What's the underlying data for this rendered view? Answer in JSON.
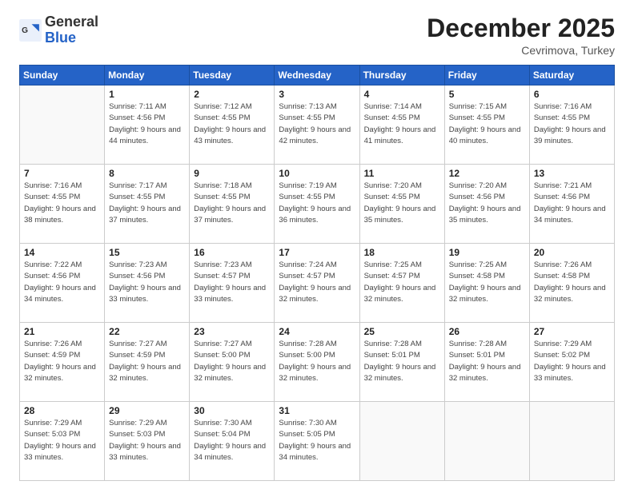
{
  "header": {
    "logo_general": "General",
    "logo_blue": "Blue",
    "month_title": "December 2025",
    "location": "Cevrimova, Turkey"
  },
  "calendar": {
    "days_of_week": [
      "Sunday",
      "Monday",
      "Tuesday",
      "Wednesday",
      "Thursday",
      "Friday",
      "Saturday"
    ],
    "weeks": [
      [
        {
          "day": "",
          "empty": true
        },
        {
          "day": "1",
          "sunrise": "7:11 AM",
          "sunset": "4:56 PM",
          "daylight": "9 hours and 44 minutes."
        },
        {
          "day": "2",
          "sunrise": "7:12 AM",
          "sunset": "4:55 PM",
          "daylight": "9 hours and 43 minutes."
        },
        {
          "day": "3",
          "sunrise": "7:13 AM",
          "sunset": "4:55 PM",
          "daylight": "9 hours and 42 minutes."
        },
        {
          "day": "4",
          "sunrise": "7:14 AM",
          "sunset": "4:55 PM",
          "daylight": "9 hours and 41 minutes."
        },
        {
          "day": "5",
          "sunrise": "7:15 AM",
          "sunset": "4:55 PM",
          "daylight": "9 hours and 40 minutes."
        },
        {
          "day": "6",
          "sunrise": "7:16 AM",
          "sunset": "4:55 PM",
          "daylight": "9 hours and 39 minutes."
        }
      ],
      [
        {
          "day": "7",
          "sunrise": "7:16 AM",
          "sunset": "4:55 PM",
          "daylight": "9 hours and 38 minutes."
        },
        {
          "day": "8",
          "sunrise": "7:17 AM",
          "sunset": "4:55 PM",
          "daylight": "9 hours and 37 minutes."
        },
        {
          "day": "9",
          "sunrise": "7:18 AM",
          "sunset": "4:55 PM",
          "daylight": "9 hours and 37 minutes."
        },
        {
          "day": "10",
          "sunrise": "7:19 AM",
          "sunset": "4:55 PM",
          "daylight": "9 hours and 36 minutes."
        },
        {
          "day": "11",
          "sunrise": "7:20 AM",
          "sunset": "4:55 PM",
          "daylight": "9 hours and 35 minutes."
        },
        {
          "day": "12",
          "sunrise": "7:20 AM",
          "sunset": "4:56 PM",
          "daylight": "9 hours and 35 minutes."
        },
        {
          "day": "13",
          "sunrise": "7:21 AM",
          "sunset": "4:56 PM",
          "daylight": "9 hours and 34 minutes."
        }
      ],
      [
        {
          "day": "14",
          "sunrise": "7:22 AM",
          "sunset": "4:56 PM",
          "daylight": "9 hours and 34 minutes."
        },
        {
          "day": "15",
          "sunrise": "7:23 AM",
          "sunset": "4:56 PM",
          "daylight": "9 hours and 33 minutes."
        },
        {
          "day": "16",
          "sunrise": "7:23 AM",
          "sunset": "4:57 PM",
          "daylight": "9 hours and 33 minutes."
        },
        {
          "day": "17",
          "sunrise": "7:24 AM",
          "sunset": "4:57 PM",
          "daylight": "9 hours and 32 minutes."
        },
        {
          "day": "18",
          "sunrise": "7:25 AM",
          "sunset": "4:57 PM",
          "daylight": "9 hours and 32 minutes."
        },
        {
          "day": "19",
          "sunrise": "7:25 AM",
          "sunset": "4:58 PM",
          "daylight": "9 hours and 32 minutes."
        },
        {
          "day": "20",
          "sunrise": "7:26 AM",
          "sunset": "4:58 PM",
          "daylight": "9 hours and 32 minutes."
        }
      ],
      [
        {
          "day": "21",
          "sunrise": "7:26 AM",
          "sunset": "4:59 PM",
          "daylight": "9 hours and 32 minutes."
        },
        {
          "day": "22",
          "sunrise": "7:27 AM",
          "sunset": "4:59 PM",
          "daylight": "9 hours and 32 minutes."
        },
        {
          "day": "23",
          "sunrise": "7:27 AM",
          "sunset": "5:00 PM",
          "daylight": "9 hours and 32 minutes."
        },
        {
          "day": "24",
          "sunrise": "7:28 AM",
          "sunset": "5:00 PM",
          "daylight": "9 hours and 32 minutes."
        },
        {
          "day": "25",
          "sunrise": "7:28 AM",
          "sunset": "5:01 PM",
          "daylight": "9 hours and 32 minutes."
        },
        {
          "day": "26",
          "sunrise": "7:28 AM",
          "sunset": "5:01 PM",
          "daylight": "9 hours and 32 minutes."
        },
        {
          "day": "27",
          "sunrise": "7:29 AM",
          "sunset": "5:02 PM",
          "daylight": "9 hours and 33 minutes."
        }
      ],
      [
        {
          "day": "28",
          "sunrise": "7:29 AM",
          "sunset": "5:03 PM",
          "daylight": "9 hours and 33 minutes."
        },
        {
          "day": "29",
          "sunrise": "7:29 AM",
          "sunset": "5:03 PM",
          "daylight": "9 hours and 33 minutes."
        },
        {
          "day": "30",
          "sunrise": "7:30 AM",
          "sunset": "5:04 PM",
          "daylight": "9 hours and 34 minutes."
        },
        {
          "day": "31",
          "sunrise": "7:30 AM",
          "sunset": "5:05 PM",
          "daylight": "9 hours and 34 minutes."
        },
        {
          "day": "",
          "empty": true
        },
        {
          "day": "",
          "empty": true
        },
        {
          "day": "",
          "empty": true
        }
      ]
    ]
  }
}
